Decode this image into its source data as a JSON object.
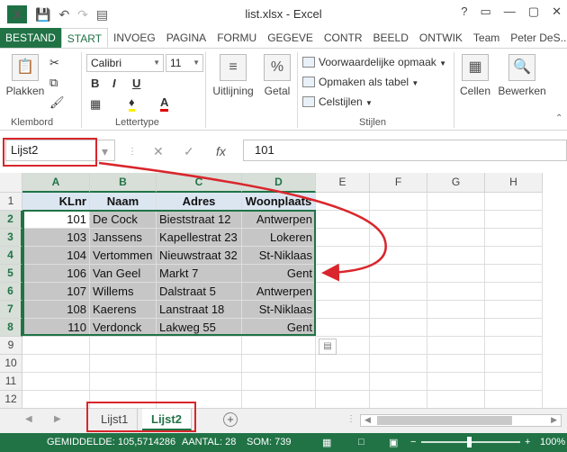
{
  "window": {
    "title": "list.xlsx - Excel",
    "controls": [
      "?",
      "▭",
      "—",
      "▢",
      "✕"
    ],
    "user": "Peter DeS..."
  },
  "qat": {
    "save_icon": "save-icon",
    "undo_icon": "undo-icon",
    "redo_icon": "redo-icon"
  },
  "tabs": [
    {
      "label": "BESTAND"
    },
    {
      "label": "START"
    },
    {
      "label": "INVOEG"
    },
    {
      "label": "PAGINA"
    },
    {
      "label": "FORMU"
    },
    {
      "label": "GEGEVE"
    },
    {
      "label": "CONTR"
    },
    {
      "label": "BEELD"
    },
    {
      "label": "ONTWIK"
    },
    {
      "label": "Team"
    }
  ],
  "ribbon": {
    "clipboard": {
      "paste": "Plakken",
      "group": "Klembord"
    },
    "font": {
      "name": "Calibri",
      "size": "11",
      "bold": "B",
      "italic": "I",
      "underline": "U",
      "group": "Lettertype"
    },
    "alignment": {
      "label": "Uitlijning"
    },
    "number": {
      "label": "Getal"
    },
    "styles": {
      "conditional": "Voorwaardelijke opmaak",
      "as_table": "Opmaken als tabel",
      "cell_styles": "Celstijlen",
      "group": "Stijlen"
    },
    "cells": {
      "label": "Cellen"
    },
    "editing": {
      "label": "Bewerken"
    }
  },
  "formula_bar": {
    "name_box": "Lijst2",
    "value": "101",
    "fx": "fx"
  },
  "columns": [
    "A",
    "B",
    "C",
    "D",
    "E",
    "F",
    "G",
    "H"
  ],
  "rows": [
    "1",
    "2",
    "3",
    "4",
    "5",
    "6",
    "7",
    "8",
    "9",
    "10",
    "11",
    "12"
  ],
  "table": {
    "headers": [
      "KLnr",
      "Naam",
      "Adres",
      "Woonplaats"
    ],
    "records": [
      [
        "101",
        "De Cock",
        "Bieststraat 12",
        "Antwerpen"
      ],
      [
        "103",
        "Janssens",
        "Kapellestrat 23",
        "Lokeren"
      ],
      [
        "104",
        "Vertommen",
        "Nieuwstraat 32",
        "St-Niklaas"
      ],
      [
        "106",
        "Van Geel",
        "Markt 7",
        "Gent"
      ],
      [
        "107",
        "Willems",
        "Dalstraat 5",
        "Antwerpen"
      ],
      [
        "108",
        "Kaerens",
        "Lanstraat 18",
        "St-Niklaas"
      ],
      [
        "110",
        "Verdonck",
        "Lakweg 55",
        "Gent"
      ]
    ]
  },
  "sheets": [
    {
      "label": "Lijst1",
      "active": false
    },
    {
      "label": "Lijst2",
      "active": true
    }
  ],
  "status": {
    "average": "GEMIDDELDE: 105,5714286",
    "count": "AANTAL: 28",
    "sum": "SOM: 739",
    "zoom": "100%"
  },
  "colors": {
    "accent": "#217346",
    "annotation": "#d9262c",
    "selection": "#c6c6c6"
  }
}
